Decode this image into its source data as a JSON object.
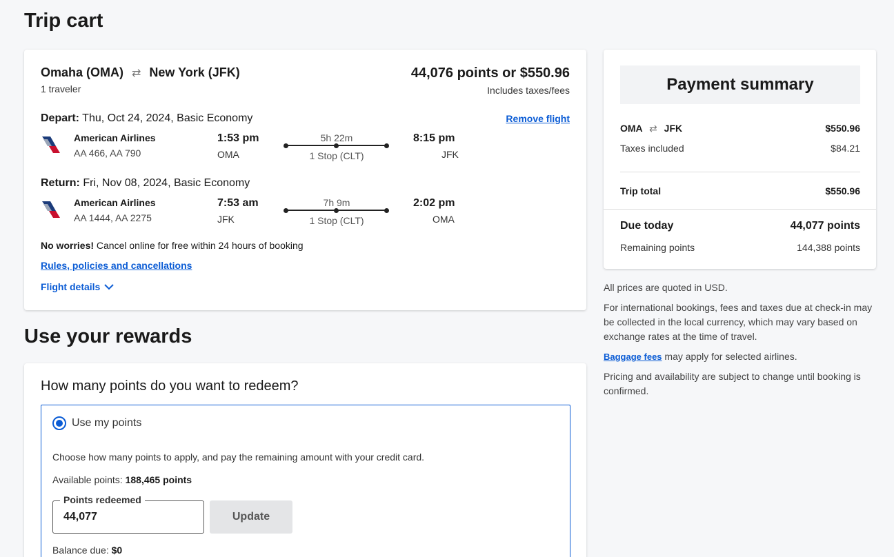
{
  "page": {
    "title": "Trip cart"
  },
  "trip": {
    "origin": "Omaha (OMA)",
    "destination": "New York (JFK)",
    "travelers": "1 traveler",
    "price": "44,076 points or $550.96",
    "price_note": "Includes taxes/fees",
    "remove_label": "Remove flight",
    "depart": {
      "label": "Depart:",
      "date": " Thu, Oct 24, 2024, Basic Economy",
      "airline": "American Airlines",
      "flights": "AA 466, AA 790",
      "dep_time": "1:53 pm",
      "dep_airport": "OMA",
      "duration": "5h 22m",
      "stops": "1 Stop (CLT)",
      "arr_time": "8:15 pm",
      "arr_airport": "JFK"
    },
    "return": {
      "label": "Return:",
      "date": " Fri, Nov 08, 2024, Basic Economy",
      "airline": "American Airlines",
      "flights": "AA 1444, AA 2275",
      "dep_time": "7:53 am",
      "dep_airport": "JFK",
      "duration": "7h 9m",
      "stops": "1 Stop (CLT)",
      "arr_time": "2:02 pm",
      "arr_airport": "OMA"
    },
    "notice_bold": "No worries!",
    "notice_text": " Cancel online for free within 24 hours of booking",
    "rules_label": "Rules, policies and cancellations",
    "details_label": "Flight details"
  },
  "rewards": {
    "section_title": "Use your rewards",
    "question": "How many points do you want to redeem?",
    "option_label": "Use my points",
    "choose_text": "Choose how many points to apply, and pay the remaining amount with your credit card.",
    "available_label": "Available points: ",
    "available_value": "188,465 points",
    "field_label": "Points redeemed",
    "field_value": "44,077",
    "update_label": "Update",
    "balance_label": "Balance due: ",
    "balance_value": "$0"
  },
  "summary": {
    "title": "Payment summary",
    "route_from": "OMA",
    "route_to": "JFK",
    "route_price": "$550.96",
    "taxes_label": "Taxes included",
    "taxes_value": "$84.21",
    "total_label": "Trip total",
    "total_value": "$550.96",
    "due_label": "Due today",
    "due_value": "44,077 points",
    "remaining_label": "Remaining points",
    "remaining_value": "144,388 points"
  },
  "notes": {
    "usd": "All prices are quoted in USD.",
    "international": "For international bookings, fees and taxes due at check-in may be collected in the local currency, which may vary based on exchange rates at the time of travel.",
    "baggage_link": "Baggage fees",
    "baggage_text": " may apply for selected airlines.",
    "pricing": "Pricing and availability are subject to change until booking is confirmed."
  },
  "colors": {
    "accent": "#0b5cd5",
    "airline_blue": "#1b3b7a",
    "airline_red": "#c8102e"
  }
}
